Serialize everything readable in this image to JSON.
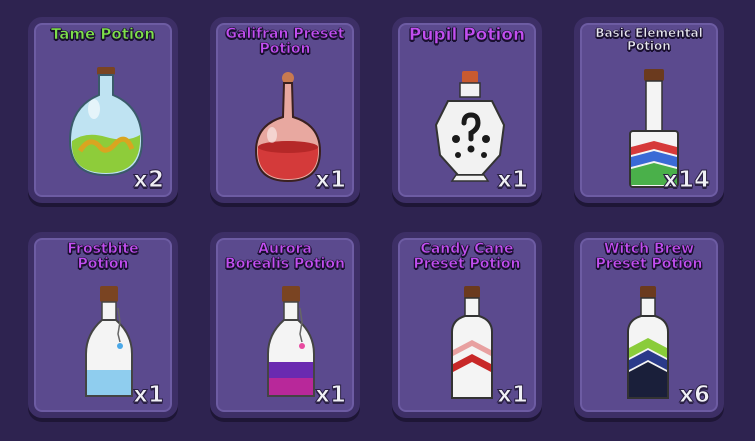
{
  "inventory": {
    "items": [
      {
        "name": "Tame Potion",
        "count": "x2",
        "color": "#7ee04a",
        "icon": "round-flask-icon"
      },
      {
        "name": "Galifran Preset\nPotion",
        "count": "x1",
        "color": "#c24ef0",
        "icon": "round-flask-icon"
      },
      {
        "name": "Pupil Potion",
        "count": "x1",
        "color": "#c24ef0",
        "icon": "pupil-bottle-icon"
      },
      {
        "name": "Basic Elemental\nPotion",
        "count": "x14",
        "color": "#e8e8f0",
        "icon": "tall-bottle-icon"
      },
      {
        "name": "Frostbite\nPotion",
        "count": "x1",
        "color": "#c24ef0",
        "icon": "corked-vial-icon"
      },
      {
        "name": "Aurora\nBorealis Potion",
        "count": "x1",
        "color": "#c24ef0",
        "icon": "corked-vial-icon"
      },
      {
        "name": "Candy Cane\nPreset Potion",
        "count": "x1",
        "color": "#c24ef0",
        "icon": "tall-bottle-icon"
      },
      {
        "name": "Witch Brew\nPreset Potion",
        "count": "x6",
        "color": "#c24ef0",
        "icon": "tall-bottle-icon"
      }
    ]
  }
}
